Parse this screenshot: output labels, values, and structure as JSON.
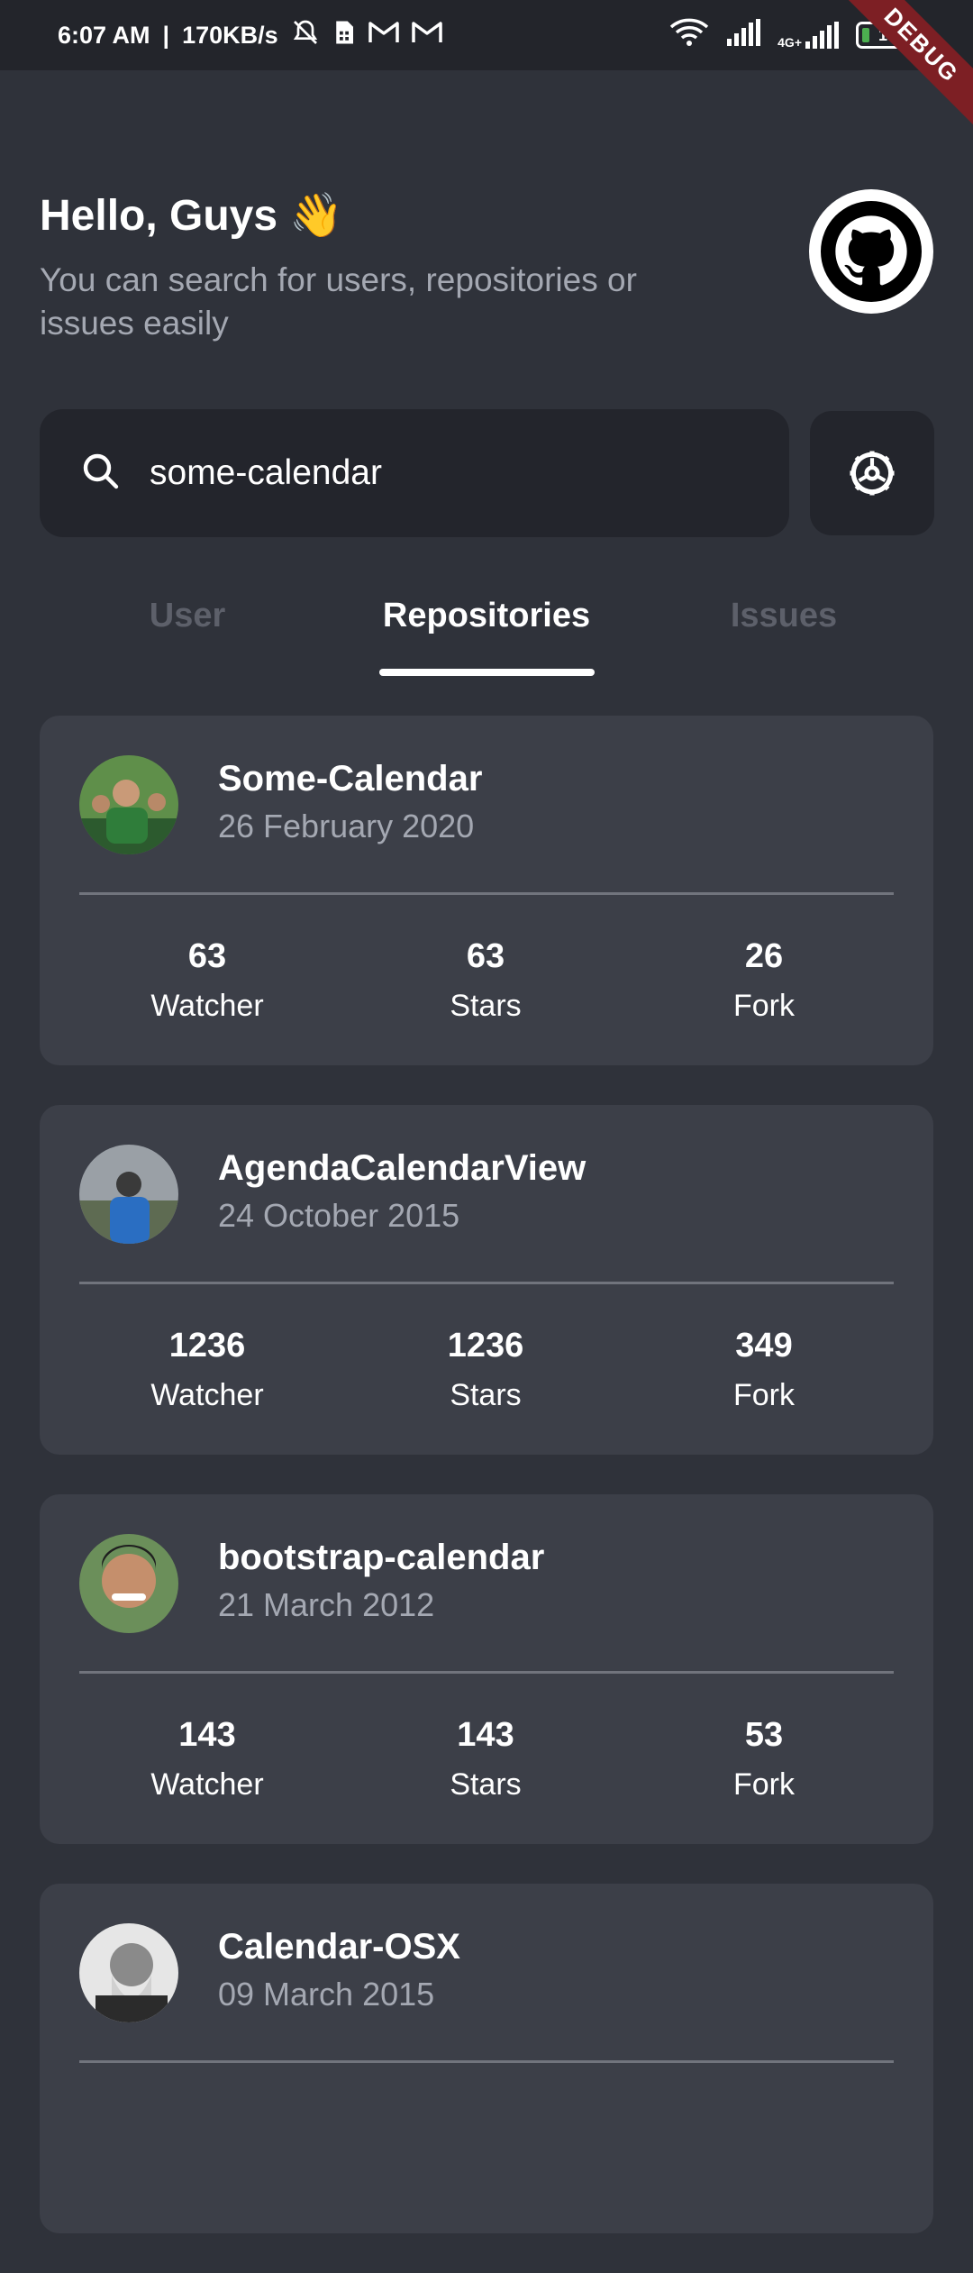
{
  "status_bar": {
    "time": "6:07 AM",
    "speed": "170KB/s",
    "battery": "10",
    "debug_label": "DEBUG",
    "network_label": "4G+"
  },
  "header": {
    "greeting": "Hello, Guys 👋",
    "subtitle": "You can search for users, repositories or issues easily"
  },
  "search": {
    "value": "some-calendar"
  },
  "tabs": [
    {
      "label": "User"
    },
    {
      "label": "Repositories"
    },
    {
      "label": "Issues"
    }
  ],
  "active_tab": "Repositories",
  "repos": [
    {
      "name": "Some-Calendar",
      "date": "26 February 2020",
      "watcher": "63",
      "watcher_label": "Watcher",
      "stars": "63",
      "stars_label": "Stars",
      "fork": "26",
      "fork_label": "Fork"
    },
    {
      "name": "AgendaCalendarView",
      "date": "24 October 2015",
      "watcher": "1236",
      "watcher_label": "Watcher",
      "stars": "1236",
      "stars_label": "Stars",
      "fork": "349",
      "fork_label": "Fork"
    },
    {
      "name": "bootstrap-calendar",
      "date": "21 March 2012",
      "watcher": "143",
      "watcher_label": "Watcher",
      "stars": "143",
      "stars_label": "Stars",
      "fork": "53",
      "fork_label": "Fork"
    },
    {
      "name": "Calendar-OSX",
      "date": "09 March 2015"
    }
  ],
  "colors": {
    "background": "#2f323a",
    "card": "#3c3f48",
    "muted_text": "#a4a8b2",
    "inactive_tab": "#5d606a"
  }
}
